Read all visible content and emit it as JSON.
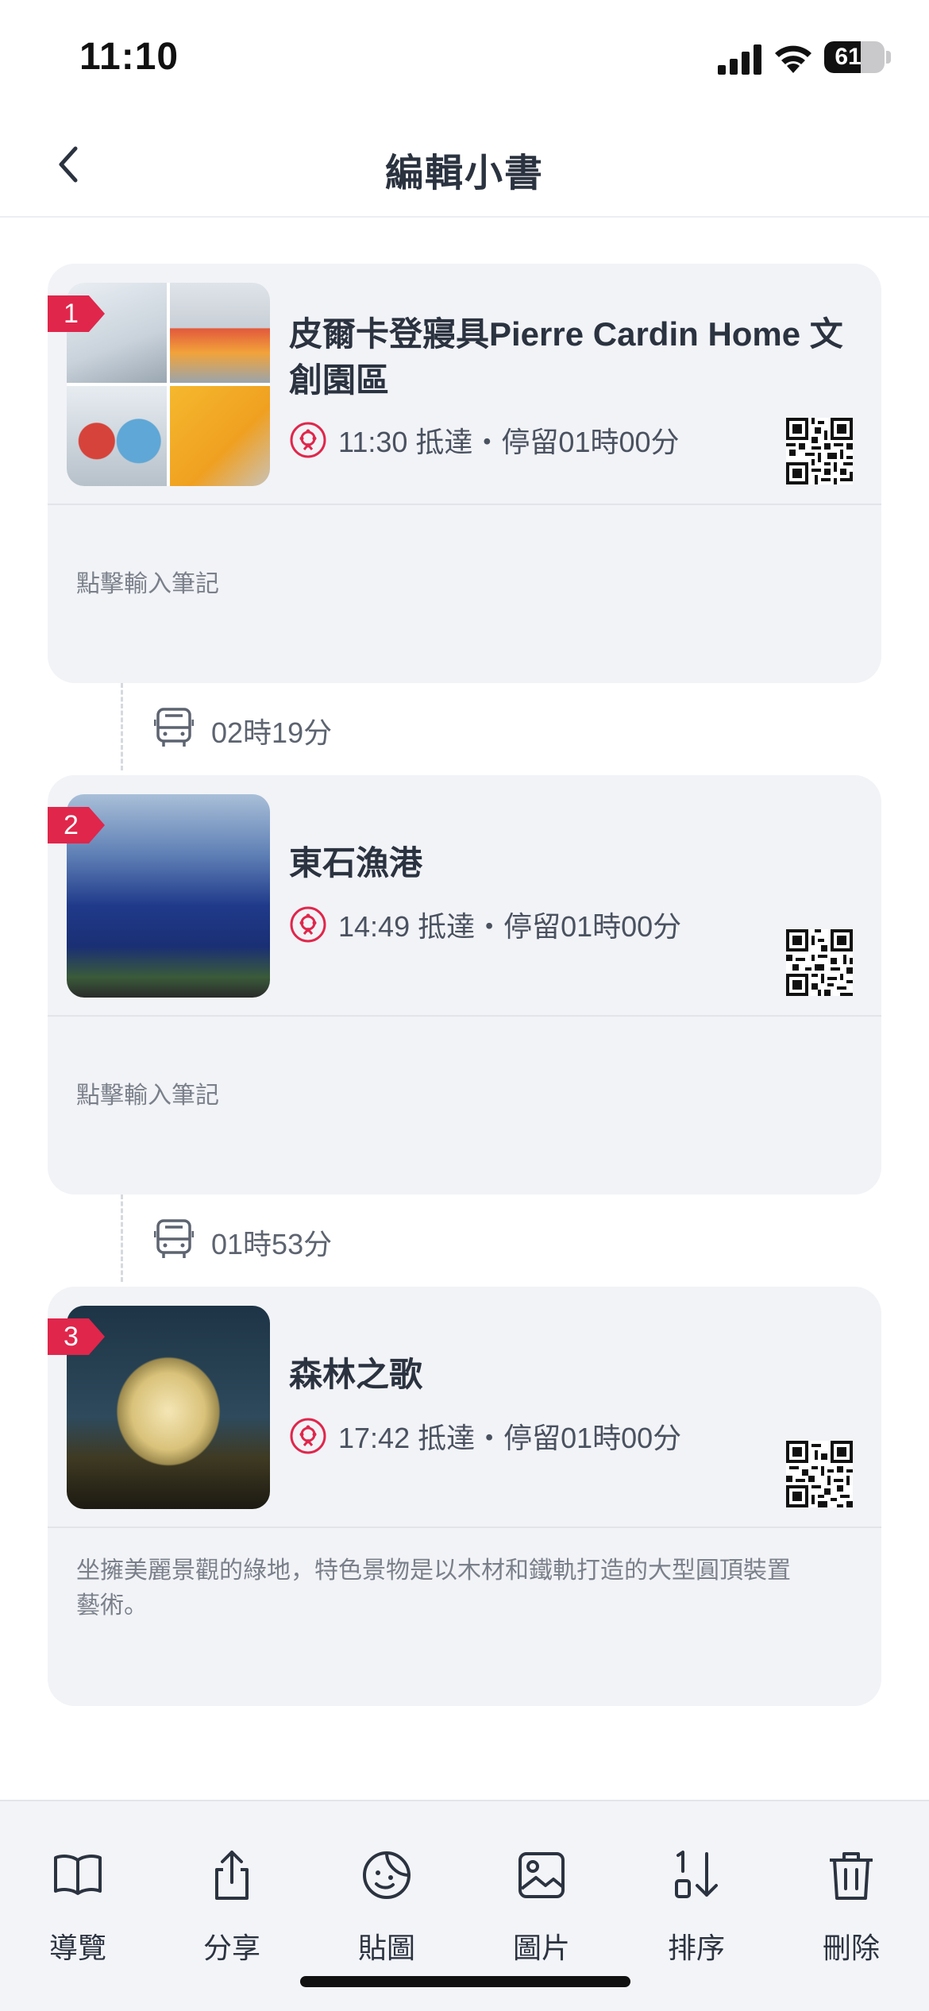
{
  "status_bar": {
    "time": "11:10",
    "battery_level": "61",
    "battery_fraction": 0.61
  },
  "nav": {
    "title": "編輯小書"
  },
  "stops": [
    {
      "index": "1",
      "name": "皮爾卡登寢具Pierre Cardin Home 文創園區",
      "arrival": "11:30 抵達・停留01時00分",
      "note": "點擊輸入筆記"
    },
    {
      "index": "2",
      "name": "東石漁港",
      "arrival": "14:49 抵達・停留01時00分",
      "note": "點擊輸入筆記"
    },
    {
      "index": "3",
      "name": "森林之歌",
      "arrival": "17:42 抵達・停留01時00分",
      "note": "坐擁美麗景觀的綠地，特色景物是以木材和鐵軌打造的大型圓頂裝置藝術。"
    }
  ],
  "transits": [
    {
      "duration": "02時19分",
      "icon": "bus-icon"
    },
    {
      "duration": "01時53分",
      "icon": "bus-icon"
    }
  ],
  "tabs": [
    {
      "label": "導覽",
      "icon": "book-icon"
    },
    {
      "label": "分享",
      "icon": "share-icon"
    },
    {
      "label": "貼圖",
      "icon": "sticker-icon"
    },
    {
      "label": "圖片",
      "icon": "image-icon"
    },
    {
      "label": "排序",
      "icon": "sort-icon"
    },
    {
      "label": "刪除",
      "icon": "trash-icon"
    }
  ],
  "colors": {
    "accent": "#e0264b",
    "card_bg": "#f2f3f7",
    "text": "#2b3340"
  }
}
